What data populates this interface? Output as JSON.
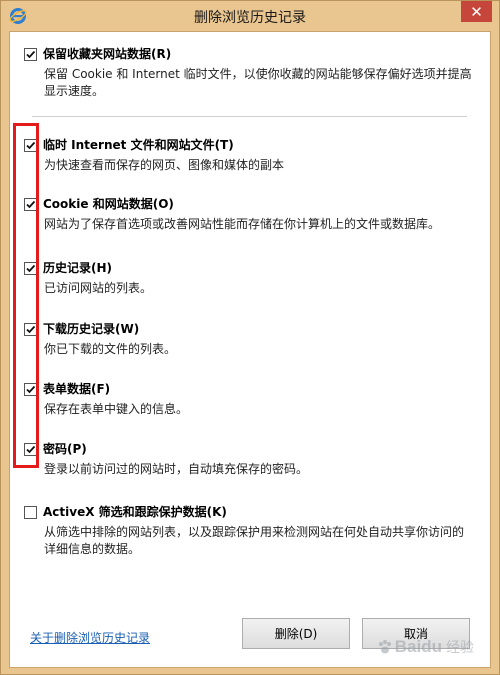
{
  "window": {
    "title": "删除浏览历史记录",
    "close_glyph": "✕",
    "app_icon": "internet-explorer-icon"
  },
  "options": [
    {
      "id": "favorites",
      "checked": true,
      "title": "保留收藏夹网站数据(R)",
      "description": "保留 Cookie 和 Internet 临时文件，以使你收藏的网站能够保存偏好选项并提高显示速度。"
    },
    {
      "id": "temp-files",
      "checked": true,
      "title": "临时 Internet 文件和网站文件(T)",
      "description": "为快速查看而保存的网页、图像和媒体的副本"
    },
    {
      "id": "cookies",
      "checked": true,
      "title": "Cookie 和网站数据(O)",
      "description": "网站为了保存首选项或改善网站性能而存储在你计算机上的文件或数据库。"
    },
    {
      "id": "history",
      "checked": true,
      "title": "历史记录(H)",
      "description": "已访问网站的列表。"
    },
    {
      "id": "download-history",
      "checked": true,
      "title": "下载历史记录(W)",
      "description": "你已下载的文件的列表。"
    },
    {
      "id": "form-data",
      "checked": true,
      "title": "表单数据(F)",
      "description": "保存在表单中键入的信息。"
    },
    {
      "id": "passwords",
      "checked": true,
      "title": "密码(P)",
      "description": "登录以前访问过的网站时，自动填充保存的密码。"
    },
    {
      "id": "activex",
      "checked": false,
      "title": "ActiveX 筛选和跟踪保护数据(K)",
      "description": "从筛选中排除的网站列表，以及跟踪保护用来检测网站在何处自动共享你访问的详细信息的数据。"
    }
  ],
  "footer": {
    "help_link": "关于删除浏览历史记录",
    "delete_button": "删除(D)",
    "cancel_button": "取消"
  },
  "watermark": {
    "brand": "Baidu",
    "sub": "经验"
  },
  "colors": {
    "frame": "#e9c58f",
    "highlight": "#e41b1b",
    "link": "#1a5fb4",
    "close": "#c7463b"
  }
}
